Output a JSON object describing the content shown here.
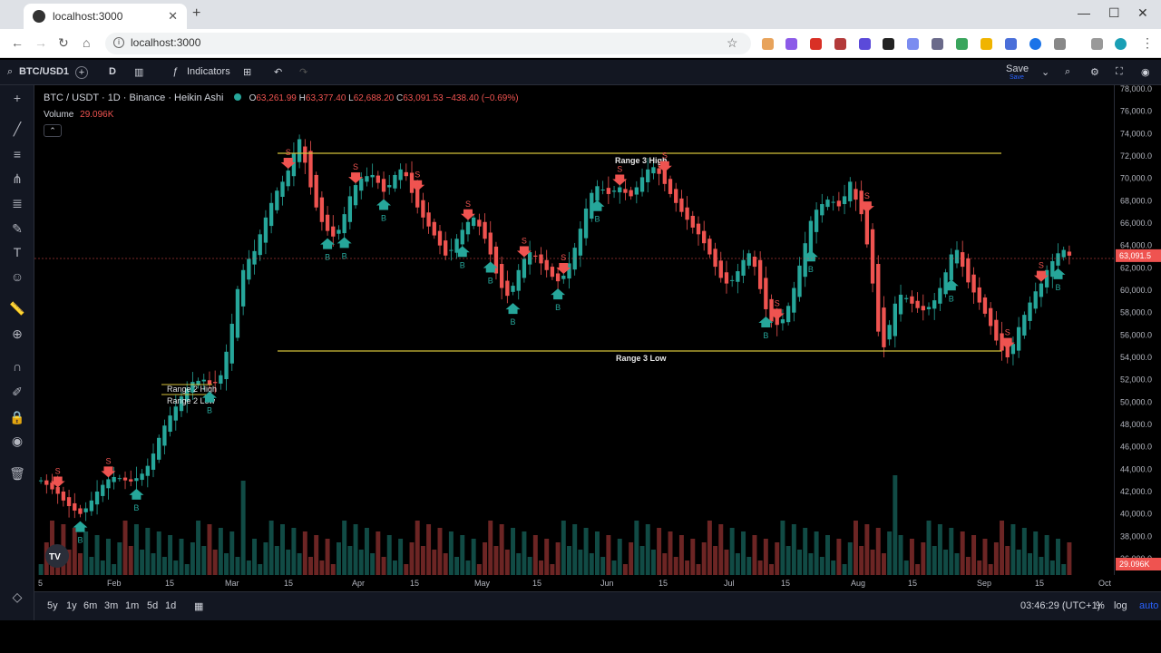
{
  "browser": {
    "tab_title": "localhost:3000",
    "url": "localhost:3000"
  },
  "toolbar": {
    "symbol": "BTC/USD1",
    "interval": "D",
    "indicators_label": "Indicators",
    "save_label": "Save",
    "save_sub": "Save"
  },
  "legend": {
    "symbol_line": "BTC / USDT · 1D · Binance · Heikin Ashi",
    "o_label": "O",
    "o_value": "63,261.99",
    "h_label": "H",
    "h_value": "63,377.40",
    "l_label": "L",
    "l_value": "62,688.20",
    "c_label": "C",
    "c_value": "63,091.53",
    "change": "−438.40 (−0.69%)",
    "volume_label": "Volume",
    "volume_value": "29.096K"
  },
  "colors": {
    "up": "#26a69a",
    "down": "#ef5350",
    "range_line": "#d4c13a",
    "background": "#000000"
  },
  "price_axis": [
    "78,000.0",
    "76,000.0",
    "74,000.0",
    "72,000.0",
    "70,000.0",
    "68,000.0",
    "66,000.0",
    "64,000.0",
    "62,000.0",
    "60,000.0",
    "58,000.0",
    "56,000.0",
    "54,000.0",
    "52,000.0",
    "50,000.0",
    "48,000.0",
    "46,000.0",
    "44,000.0",
    "42,000.0",
    "40,000.0",
    "38,000.0",
    "36,000.0"
  ],
  "last_price_label": "63,091.5",
  "volume_axis_label": "29.096K",
  "time_axis": [
    "5",
    "Feb",
    "15",
    "Mar",
    "15",
    "Apr",
    "15",
    "May",
    "15",
    "Jun",
    "15",
    "Jul",
    "15",
    "Aug",
    "15",
    "Sep",
    "15",
    "Oct"
  ],
  "annotations": {
    "range3_high": "Range 3 High",
    "range3_low": "Range 3 Low",
    "range2_high": "Range 2 High",
    "range2_low": "Range 2 Low",
    "sell_letter": "S",
    "buy_letter": "B"
  },
  "bottom": {
    "ranges": [
      "5y",
      "1y",
      "6m",
      "3m",
      "1m",
      "5d",
      "1d"
    ],
    "clock": "03:46:29 (UTC+1)",
    "percent": "%",
    "log": "log",
    "auto": "auto"
  },
  "chart_data": {
    "type": "candlestick",
    "title": "BTC / USDT · 1D · Binance · Heikin Ashi",
    "ylim": [
      36000,
      78000
    ],
    "closes": [
      43000,
      42600,
      42200,
      41800,
      41200,
      40700,
      40300,
      40000,
      40500,
      41200,
      42000,
      42600,
      43100,
      43300,
      43200,
      43000,
      42900,
      43200,
      43600,
      44300,
      45400,
      46800,
      47900,
      48800,
      49600,
      50500,
      51200,
      51800,
      51900,
      52000,
      51600,
      51700,
      52400,
      54500,
      57000,
      60100,
      61800,
      62800,
      63500,
      65000,
      66500,
      67800,
      68900,
      69700,
      70700,
      72200,
      73500,
      71400,
      69200,
      67400,
      66100,
      65300,
      64800,
      65400,
      66800,
      68400,
      69400,
      70000,
      70200,
      70300,
      69600,
      68800,
      69400,
      70300,
      70800,
      70200,
      68700,
      67400,
      66500,
      65700,
      64900,
      64000,
      63100,
      63600,
      64600,
      65400,
      66100,
      66500,
      65700,
      64600,
      63200,
      61500,
      60200,
      59500,
      60400,
      61800,
      62800,
      63400,
      63000,
      62400,
      61800,
      61200,
      60800,
      61300,
      62400,
      63800,
      65500,
      67300,
      68700,
      69300,
      69000,
      68600,
      68900,
      69200,
      68700,
      68400,
      69200,
      70100,
      70800,
      71000,
      70400,
      69500,
      68600,
      67800,
      67000,
      66300,
      65600,
      65000,
      64200,
      63200,
      62100,
      61100,
      60600,
      60900,
      61700,
      62700,
      63300,
      62100,
      60100,
      58300,
      57200,
      56900,
      57400,
      58600,
      60200,
      62200,
      64200,
      66200,
      67200,
      67700,
      68100,
      67900,
      67500,
      68400,
      69700,
      68100,
      66800,
      64100,
      60600,
      56300,
      54900,
      56900,
      58800,
      59600,
      59300,
      58800,
      58400,
      58200,
      58500,
      59100,
      60200,
      61600,
      63200,
      63600,
      62100,
      60700,
      59800,
      58900,
      57900,
      56800,
      55500,
      54600,
      54000,
      55200,
      56700,
      57800,
      58900,
      59900,
      60600,
      61800,
      62600,
      63300,
      63600,
      63091
    ]
  }
}
